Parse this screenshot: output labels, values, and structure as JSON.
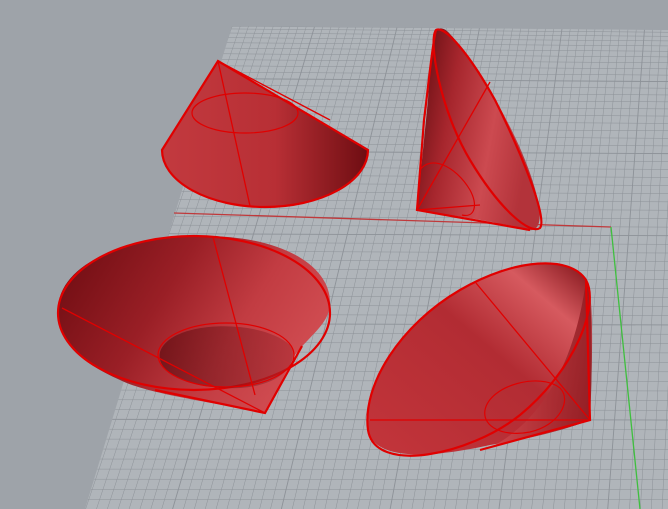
{
  "viewport": {
    "background": "#9ea3a9",
    "grid_plane_color": "#b0b5ba",
    "grid_line_color": "#8d9298",
    "x_axis_color": "#c0393b",
    "y_axis_color": "#3fbf3f"
  },
  "objects": [
    {
      "name": "cone-upright",
      "color": "#c8323a",
      "edge_color": "#e00000"
    },
    {
      "name": "cone-tilted-right",
      "color": "#c8323a",
      "edge_color": "#e00000"
    },
    {
      "name": "cone-inverted-left",
      "color": "#c8323a",
      "edge_color": "#e00000"
    },
    {
      "name": "cone-inverted-right",
      "color": "#c8323a",
      "edge_color": "#e00000"
    }
  ]
}
